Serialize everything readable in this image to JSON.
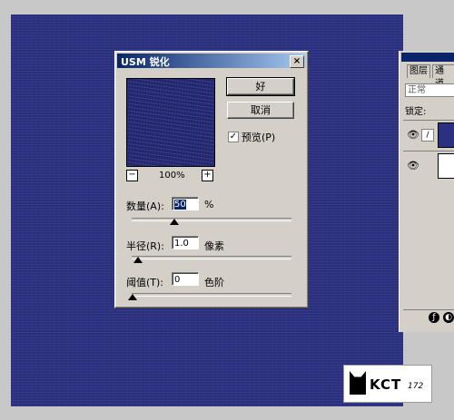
{
  "dialog": {
    "title": "USM 锐化",
    "close": "×",
    "ok_label": "好",
    "cancel_label": "取消",
    "preview": {
      "label": "预览(P)",
      "checked": true,
      "check_mark": "✓"
    },
    "zoom": {
      "minus": "−",
      "plus": "+",
      "value": "100%"
    },
    "amount": {
      "label": "数量(A):",
      "value": "50",
      "unit": "%",
      "slider_fraction": 0.1
    },
    "radius": {
      "label": "半径(R):",
      "value": "1.0",
      "unit": "像素",
      "slider_fraction": 0.01
    },
    "threshold": {
      "label": "阈值(T):",
      "value": "0",
      "unit": "色阶",
      "slider_fraction": 0.0
    }
  },
  "layers_palette": {
    "tabs": [
      "图层",
      "通道"
    ],
    "blend_mode": "正常",
    "lock_label": "锁定:",
    "layers": [
      {
        "visible": true,
        "thumb_color": "#2c3080",
        "selected": true
      },
      {
        "visible": true,
        "thumb_color": "#ffffff",
        "selected": false
      }
    ]
  },
  "watermark": {
    "text": "KCT",
    "number": "172"
  },
  "colors": {
    "canvas": "#2c3080",
    "titlebar": "#0a246a",
    "dialog_bg": "#d4d0c8"
  }
}
